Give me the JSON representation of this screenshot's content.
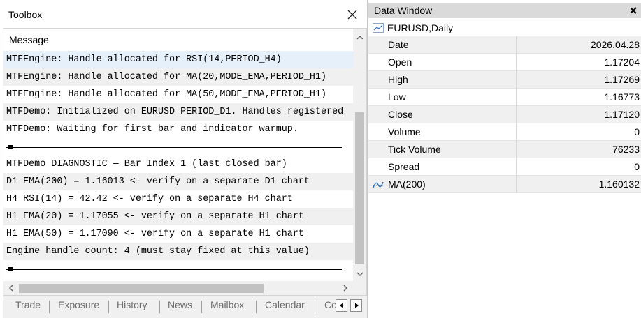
{
  "toolbox": {
    "title": "Toolbox",
    "column_header": "Message",
    "messages": [
      {
        "text": "MTFEngine: Handle allocated for RSI(14,PERIOD_H4)",
        "style": "sel"
      },
      {
        "text": "MTFEngine: Handle allocated for MA(20,MODE_EMA,PERIOD_H1)",
        "style": "alt"
      },
      {
        "text": "MTFEngine: Handle allocated for MA(50,MODE_EMA,PERIOD_H1)",
        "style": ""
      },
      {
        "text": "MTFDemo: Initialized on EURUSD PERIOD_D1. Handles registered",
        "style": "alt"
      },
      {
        "text": "MTFDemo: Waiting for first bar and indicator warmup.",
        "style": ""
      },
      {
        "text": "",
        "style": "sep"
      },
      {
        "text": "MTFDemo DIAGNOSTIC — Bar Index 1 (last closed bar)",
        "style": ""
      },
      {
        "text": "D1 EMA(200)  = 1.16013  <- verify on a separate D1 chart",
        "style": "alt"
      },
      {
        "text": "H4 RSI(14)    = 42.42   <- verify on a separate H4 chart",
        "style": ""
      },
      {
        "text": "H1 EMA(20)  = 1.17055  <- verify on a separate H1 chart",
        "style": "alt"
      },
      {
        "text": "H1 EMA(50)  = 1.17090  <- verify on a separate H1 chart",
        "style": ""
      },
      {
        "text": "Engine handle count: 4 (must stay fixed at this value)",
        "style": "alt"
      },
      {
        "text": "",
        "style": "sep"
      }
    ],
    "tabs": {
      "trade": "Trade",
      "exposure": "Exposure",
      "history": "History",
      "news": "News",
      "mailbox": "Mailbox",
      "calendar": "Calendar",
      "truncated": "Company"
    }
  },
  "data_window": {
    "title": "Data Window",
    "symbol": "EURUSD,Daily",
    "rows": [
      {
        "label": "Date",
        "value": "2026.04.28",
        "style": "grey"
      },
      {
        "label": "Open",
        "value": "1.17204",
        "style": ""
      },
      {
        "label": "High",
        "value": "1.17269",
        "style": "grey"
      },
      {
        "label": "Low",
        "value": "1.16773",
        "style": ""
      },
      {
        "label": "Close",
        "value": "1.17120",
        "style": "grey"
      },
      {
        "label": "Volume",
        "value": "0",
        "style": ""
      },
      {
        "label": "Tick Volume",
        "value": "76233",
        "style": "grey"
      },
      {
        "label": "Spread",
        "value": "0",
        "style": ""
      }
    ],
    "indicator": {
      "label": "MA(200)",
      "value": "1.160132",
      "icon": "indicator-line-icon"
    },
    "icon_color": "#2f6fb5"
  }
}
